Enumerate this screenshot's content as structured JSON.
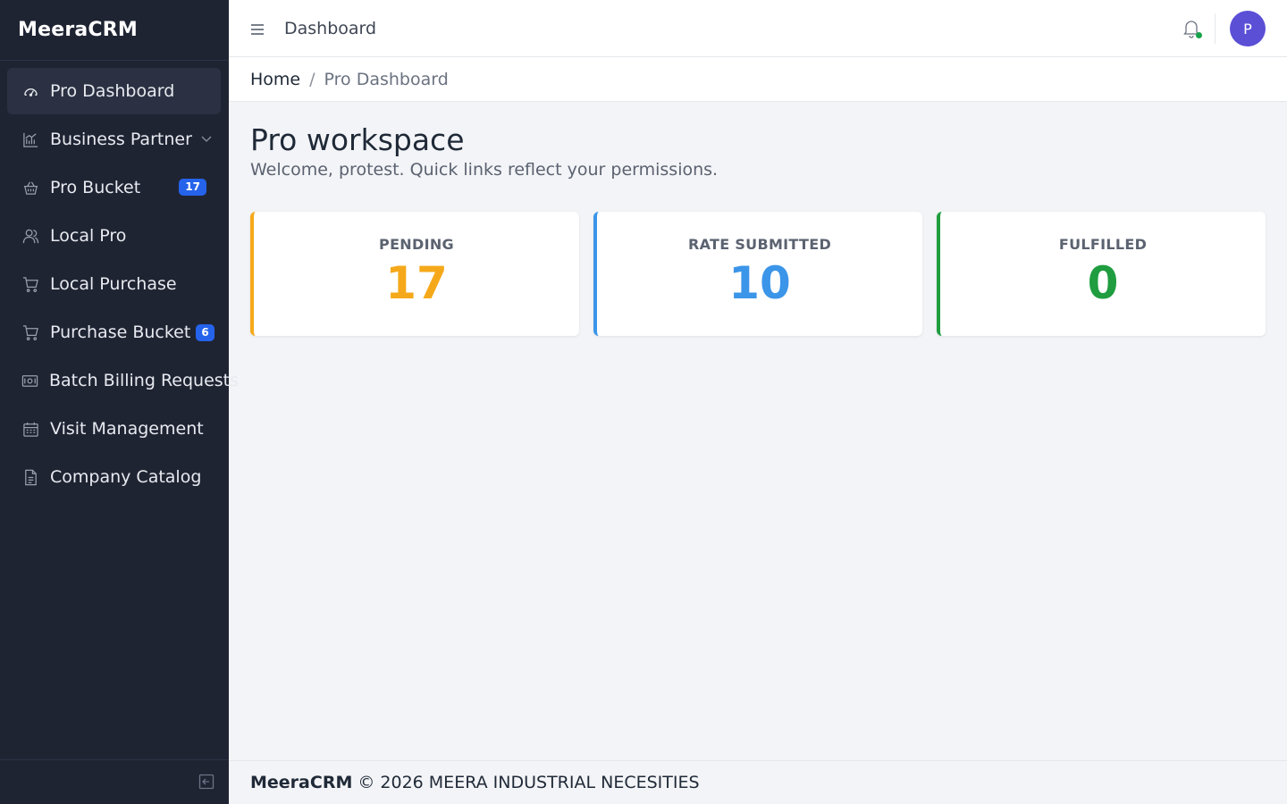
{
  "brand": "MeeraCRM",
  "topbar": {
    "title": "Dashboard",
    "avatar_initial": "P"
  },
  "breadcrumb": {
    "home": "Home",
    "separator": "/",
    "current": "Pro Dashboard"
  },
  "sidebar": {
    "items": [
      {
        "label": "Pro Dashboard",
        "icon": "dashboard-gauge-icon",
        "active": true
      },
      {
        "label": "Business Partner",
        "icon": "chart-icon",
        "has_dropdown": true
      },
      {
        "label": "Pro Bucket",
        "icon": "basket-icon",
        "badge": "17"
      },
      {
        "label": "Local Pro",
        "icon": "users-icon"
      },
      {
        "label": "Local Purchase",
        "icon": "cart-icon"
      },
      {
        "label": "Purchase Bucket",
        "icon": "cart-icon",
        "badge": "6"
      },
      {
        "label": "Batch Billing Requests",
        "icon": "billing-icon"
      },
      {
        "label": "Visit Management",
        "icon": "calendar-icon"
      },
      {
        "label": "Company Catalog",
        "icon": "document-icon"
      }
    ]
  },
  "main": {
    "title": "Pro workspace",
    "subtitle": "Welcome, protest. Quick links reflect your permissions.",
    "cards": [
      {
        "label": "PENDING",
        "value": "17",
        "color": "#f5a91a"
      },
      {
        "label": "RATE SUBMITTED",
        "value": "10",
        "color": "#3b95e8"
      },
      {
        "label": "FULFILLED",
        "value": "0",
        "color": "#1f9d3f"
      }
    ]
  },
  "footer": {
    "brand": "MeeraCRM",
    "text": "© 2026 MEERA INDUSTRIAL NECESITIES"
  },
  "colors": {
    "sidebar_bg": "#1f2433",
    "accent": "#2563eb",
    "avatar": "#5b4fd6",
    "notification_dot": "#16a34a"
  }
}
